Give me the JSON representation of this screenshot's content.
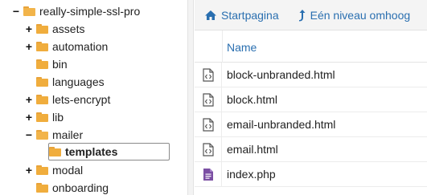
{
  "tree": {
    "root": "really-simple-ssl-pro",
    "items": [
      {
        "label": "assets",
        "toggle": "+"
      },
      {
        "label": "automation",
        "toggle": "+"
      },
      {
        "label": "bin",
        "toggle": ""
      },
      {
        "label": "languages",
        "toggle": ""
      },
      {
        "label": "lets-encrypt",
        "toggle": "+"
      },
      {
        "label": "lib",
        "toggle": "+"
      },
      {
        "label": "mailer",
        "toggle": "−"
      },
      {
        "label": "templates",
        "toggle": "",
        "selected": true
      },
      {
        "label": "modal",
        "toggle": "+"
      },
      {
        "label": "onboarding",
        "toggle": ""
      }
    ],
    "root_toggle": "−"
  },
  "toolbar": {
    "home_label": "Startpagina",
    "up_label": "Eén niveau omhoog"
  },
  "list": {
    "header_name": "Name",
    "files": [
      {
        "name": "block-unbranded.html",
        "icon": "code-file-icon"
      },
      {
        "name": "block.html",
        "icon": "code-file-icon"
      },
      {
        "name": "email-unbranded.html",
        "icon": "code-file-icon"
      },
      {
        "name": "email.html",
        "icon": "code-file-icon"
      },
      {
        "name": "index.php",
        "icon": "php-file-icon"
      }
    ]
  },
  "colors": {
    "folder": "#f0ad3d",
    "link": "#2a6fb0",
    "php": "#7b4fa3"
  }
}
